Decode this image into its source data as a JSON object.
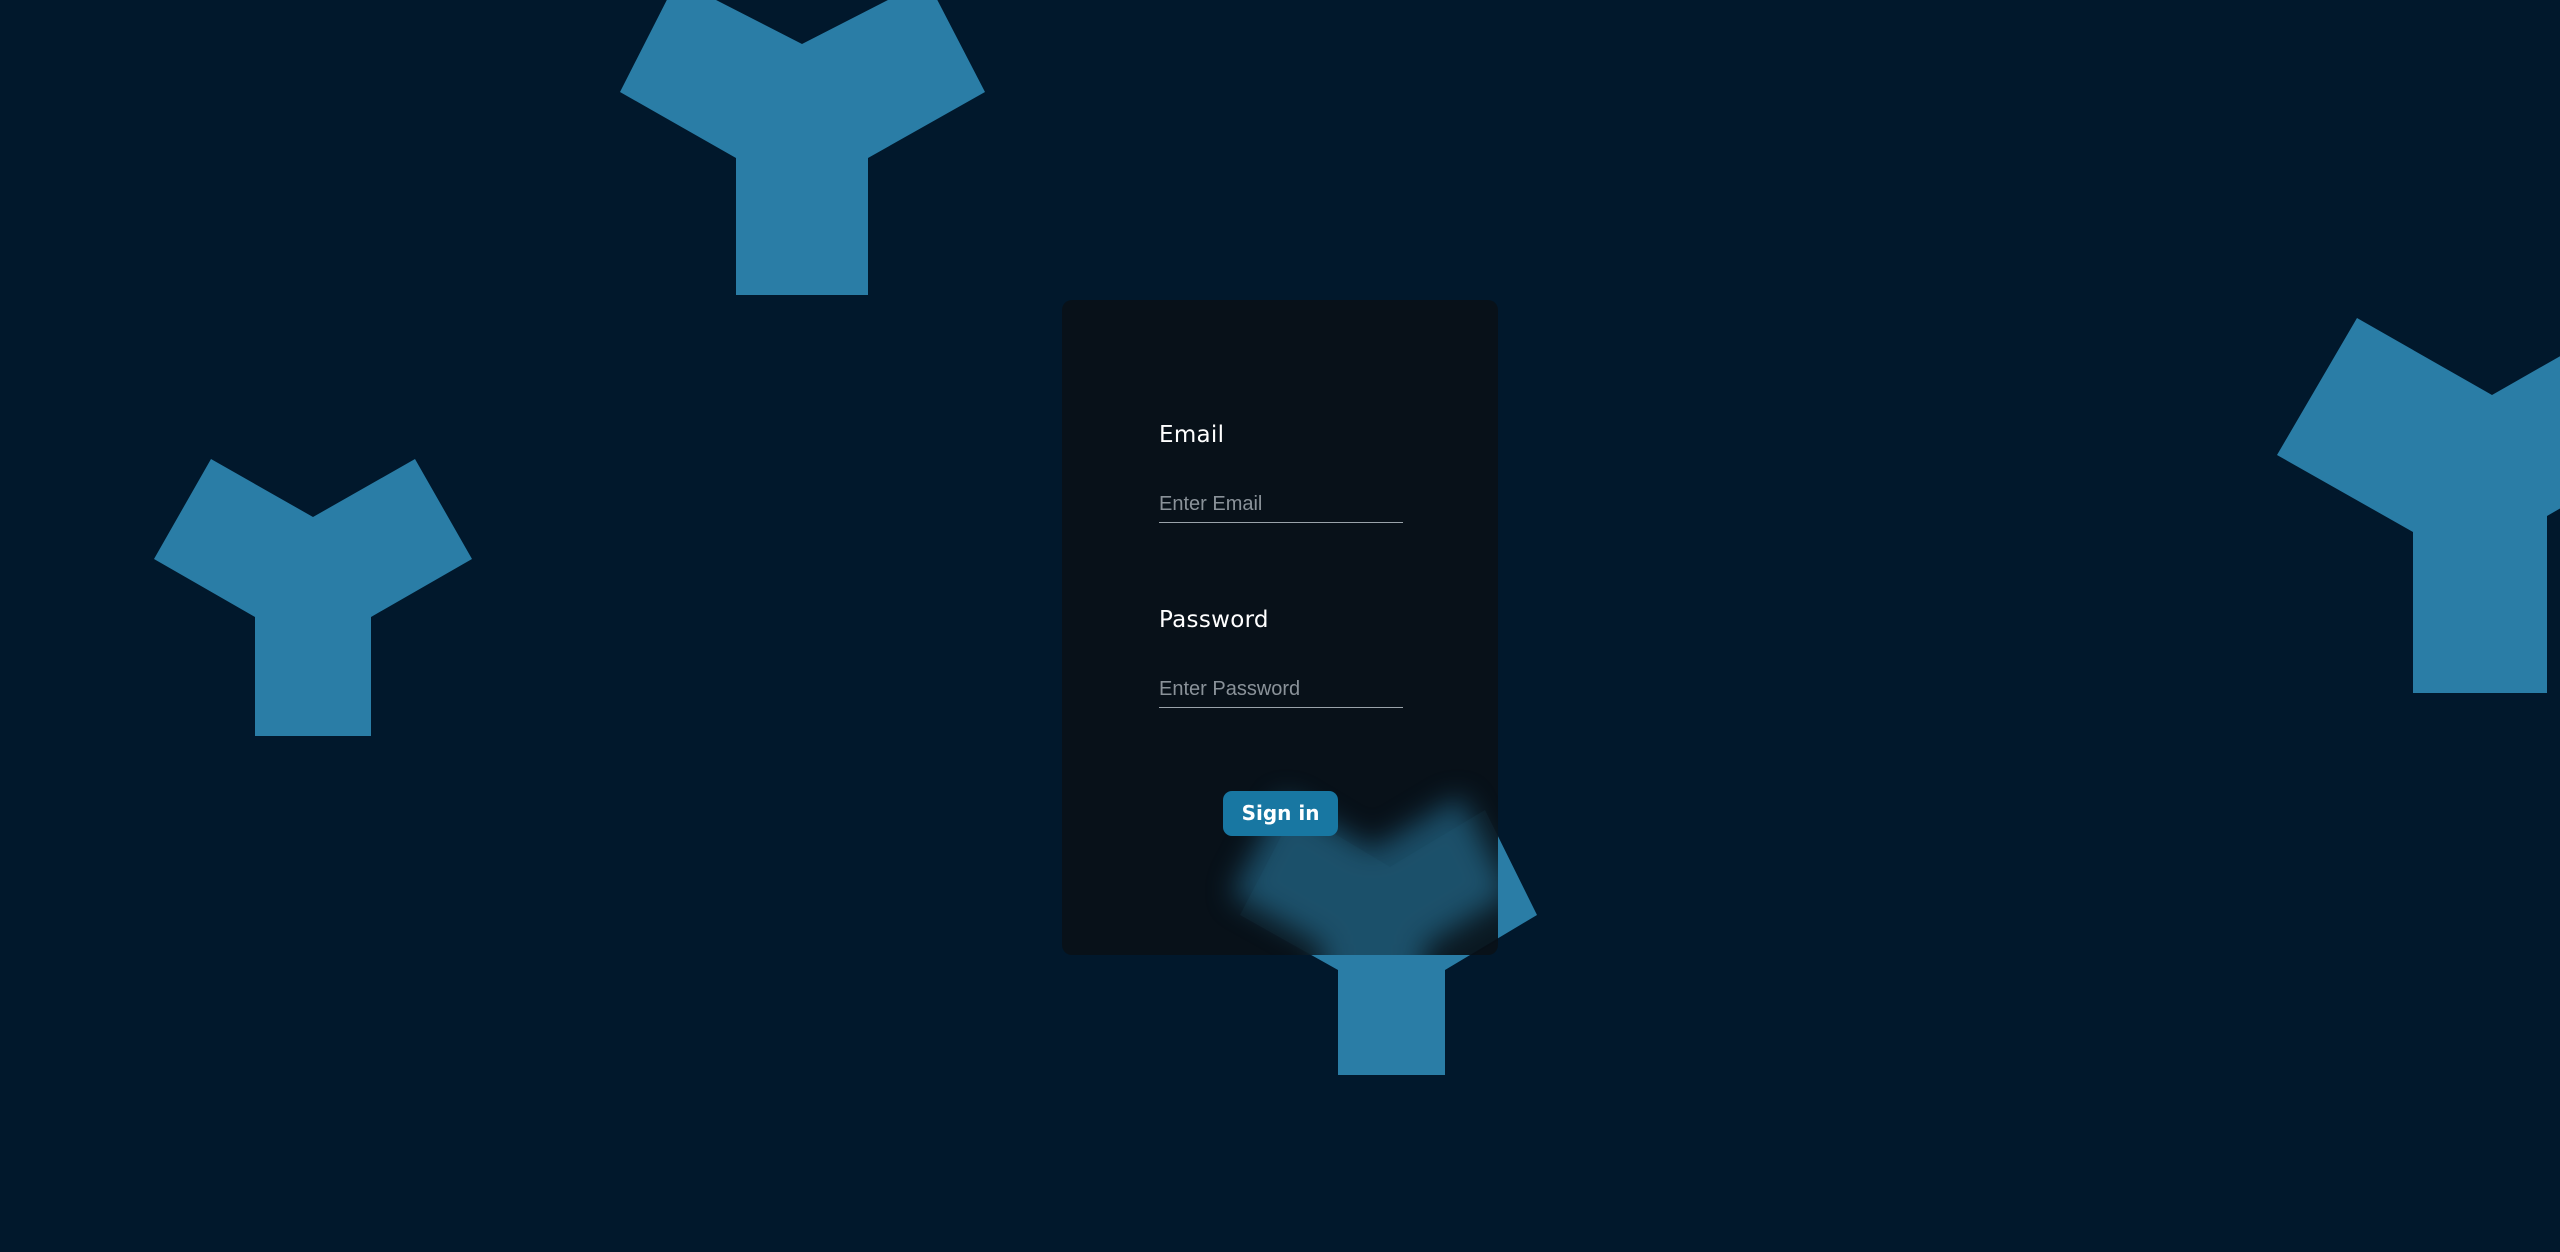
{
  "colors": {
    "background": "#01182c",
    "shape": "#2a7da6",
    "card": "#091118",
    "button": "#1877a2",
    "text": "#ffffff",
    "placeholder": "#8a9299"
  },
  "decorations": [
    "y-shape",
    "y-shape",
    "y-shape",
    "y-shape"
  ],
  "login": {
    "email_label": "Email",
    "email_placeholder": "Enter Email",
    "email_value": "",
    "password_label": "Password",
    "password_placeholder": "Enter Password",
    "password_value": "",
    "submit_label": "Sign in"
  }
}
